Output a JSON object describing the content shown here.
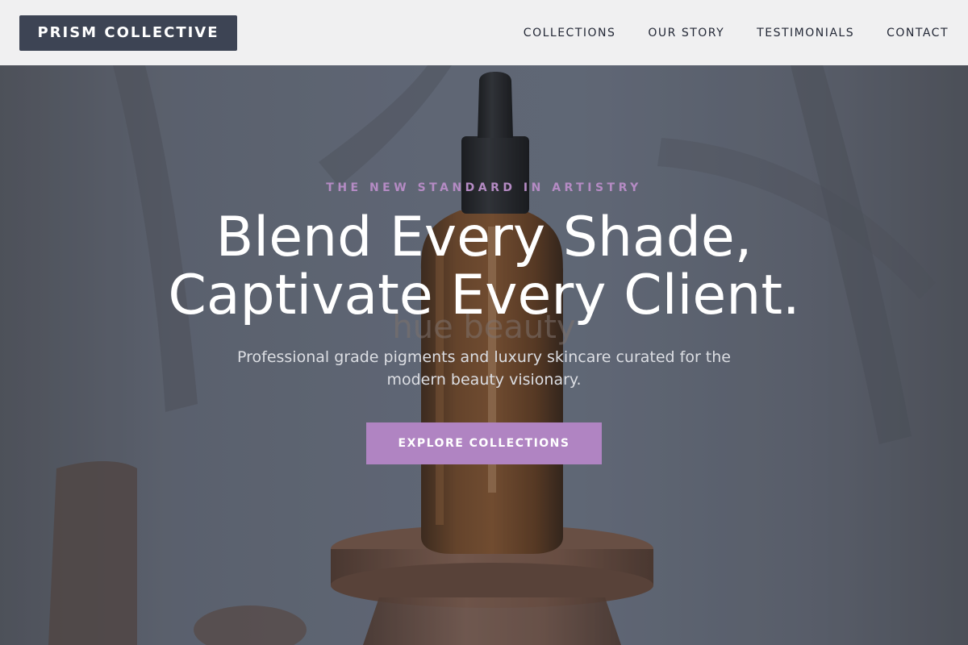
{
  "header": {
    "brand": "PRISM COLLECTIVE",
    "nav": [
      {
        "label": "COLLECTIONS"
      },
      {
        "label": "OUR STORY"
      },
      {
        "label": "TESTIMONIALS"
      },
      {
        "label": "CONTACT"
      }
    ]
  },
  "hero": {
    "eyebrow": "THE NEW STANDARD IN ARTISTRY",
    "headline_line1": "Blend Every Shade,",
    "headline_line2": "Captivate Every Client.",
    "subhead": "Professional grade pigments and luxury skincare curated for the modern beauty visionary.",
    "cta_label": "EXPLORE COLLECTIONS",
    "image_alt": "Amber glass dropper bottle on a round wooden pedestal with leaf shadows",
    "bottle_label": "hue beauty"
  },
  "colors": {
    "header_bg": "#f0f0f1",
    "logo_bg": "#3d4454",
    "accent": "#b084c2",
    "eyebrow": "#b58bc4"
  }
}
